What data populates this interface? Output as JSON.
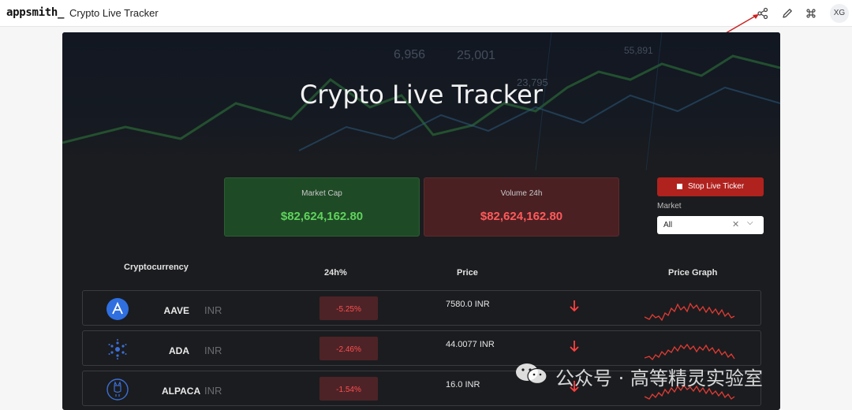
{
  "header": {
    "logo": "appsmith_",
    "app_name": "Crypto Live Tracker",
    "icons": [
      "share-icon",
      "edit-icon",
      "command-icon"
    ],
    "avatar_initials": "XG"
  },
  "hero": {
    "title": "Crypto Live Tracker",
    "background_numbers": [
      "6,956",
      "25,001",
      "23,795",
      "55,891"
    ]
  },
  "stats": {
    "market_cap": {
      "label": "Market Cap",
      "value": "$82,624,162.80",
      "color": "#5fd35c"
    },
    "volume_24h": {
      "label": "Volume 24h",
      "value": "$82,624,162.80",
      "color": "#ff5a5a"
    }
  },
  "controls": {
    "stop_button_label": "Stop Live Ticker",
    "market_label": "Market",
    "market_value": "All"
  },
  "table": {
    "headers": {
      "crypto": "Cryptocurrency",
      "change": "24h%",
      "price": "Price",
      "graph": "Price Graph"
    },
    "rows": [
      {
        "symbol": "AAVE",
        "currency": "INR",
        "change": "-5.25%",
        "price": "7580.0 INR",
        "trend": "down",
        "icon": "aave-logo-icon"
      },
      {
        "symbol": "ADA",
        "currency": "INR",
        "change": "-2.46%",
        "price": "44.0077 INR",
        "trend": "down",
        "icon": "cardano-logo-icon"
      },
      {
        "symbol": "ALPACA",
        "currency": "INR",
        "change": "-1.54%",
        "price": "16.0 INR",
        "trend": "down",
        "icon": "alpaca-logo-icon"
      }
    ]
  },
  "watermark": {
    "text": "公众号 · 高等精灵实验室"
  },
  "colors": {
    "accent_red": "#b0221e",
    "positive": "#5fd35c",
    "negative": "#ff4f4f"
  }
}
